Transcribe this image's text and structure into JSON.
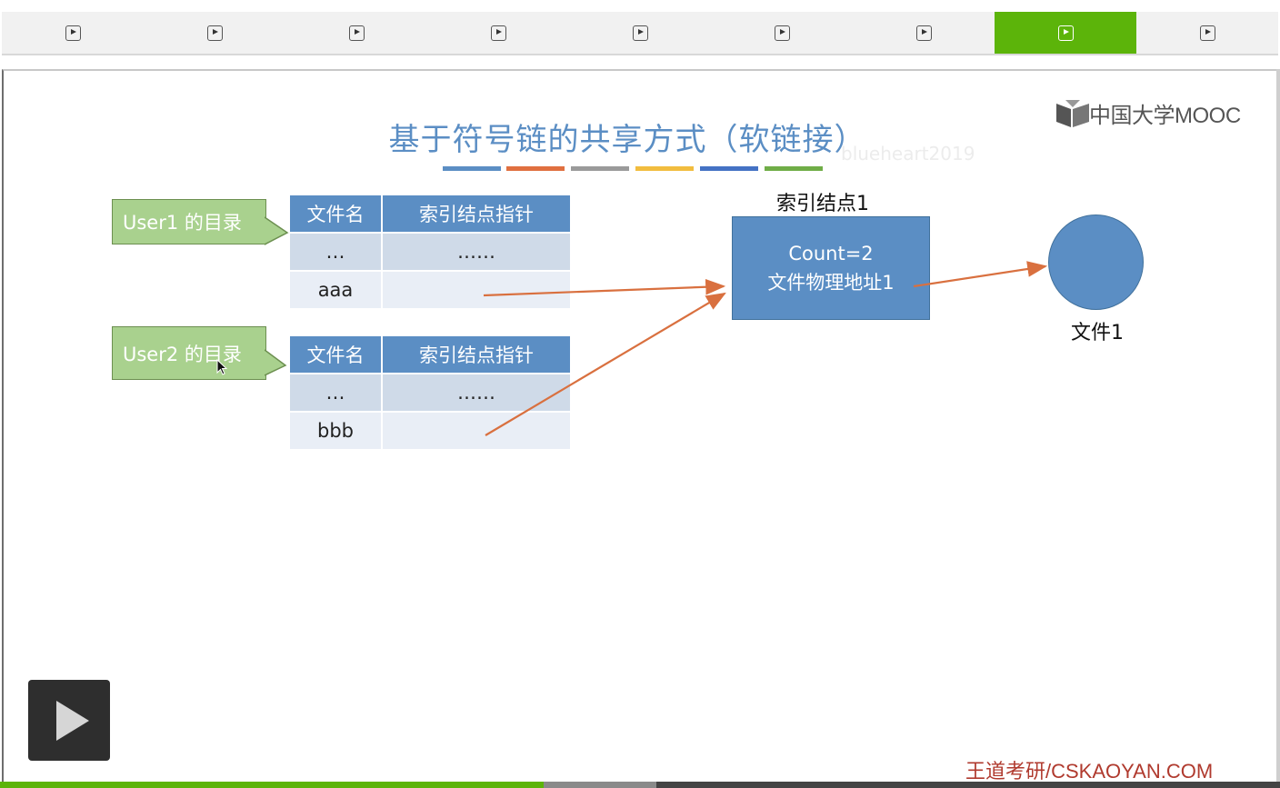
{
  "player_tabs": {
    "count": 9,
    "active_index": 7,
    "icon": "play-square-icon",
    "active_color": "#5cb40a"
  },
  "slide": {
    "title": "基于符号链的共享方式（软链接）",
    "title_color": "#5b8ec4",
    "faint_watermark": "blueheart2019",
    "color_bars": [
      "#5b8ec4",
      "#e07040",
      "#9a9a9a",
      "#f2bd3f",
      "#4472c4",
      "#70ad47"
    ],
    "logo_text": "中国大学MOOC",
    "user1_label": "User1 的目录",
    "user2_label": "User2 的目录",
    "table_headers": [
      "文件名",
      "索引结点指针"
    ],
    "user1_rows": [
      [
        "…",
        "……"
      ],
      [
        "aaa",
        ""
      ]
    ],
    "user2_rows": [
      [
        "…",
        "……"
      ],
      [
        "bbb",
        ""
      ]
    ],
    "inode_title": "索引结点1",
    "inode_line1": "Count=2",
    "inode_line2": "文件物理地址1",
    "file_label": "文件1",
    "arrow_color": "#d9703f"
  },
  "footer": {
    "watermark": "王道考研/CSKAOYAN.COM",
    "progress_played": 0.425
  },
  "controls": {
    "play_icon": "play-icon"
  }
}
